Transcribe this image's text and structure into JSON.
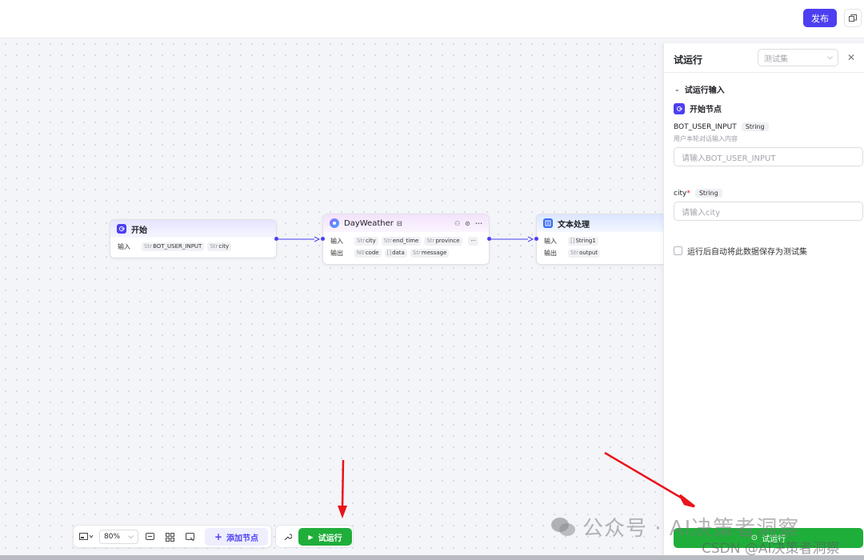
{
  "header": {
    "publish_label": "发布",
    "copy_icon": "copy-window-icon"
  },
  "nodes": {
    "start": {
      "title": "开始",
      "input_label": "输入",
      "inputs": [
        {
          "type": "Str",
          "name": "BOT_USER_INPUT"
        },
        {
          "type": "Str",
          "name": "city"
        }
      ]
    },
    "weather": {
      "title": "DayWeather",
      "input_label": "输入",
      "output_label": "输出",
      "inputs": [
        {
          "type": "Str",
          "name": "city"
        },
        {
          "type": "Str",
          "name": "end_time"
        },
        {
          "type": "Str",
          "name": "province"
        }
      ],
      "outputs": [
        {
          "type": "N0",
          "name": "code"
        },
        {
          "type": "[]",
          "name": "data"
        },
        {
          "type": "Str",
          "name": "message"
        }
      ],
      "more_label": "···"
    },
    "text": {
      "title": "文本处理",
      "input_label": "输入",
      "output_label": "输出",
      "inputs": [
        {
          "type": "[]",
          "name": "String1"
        }
      ],
      "outputs": [
        {
          "type": "Str",
          "name": "output"
        }
      ]
    }
  },
  "panel": {
    "title": "试运行",
    "select_placeholder": "测试集",
    "section_title": "试运行输入",
    "start_node_title": "开始节点",
    "field1": {
      "name": "BOT_USER_INPUT",
      "type": "String",
      "description": "用户本轮对话输入内容",
      "placeholder": "请输入BOT_USER_INPUT"
    },
    "field2": {
      "name": "city",
      "required_mark": "*",
      "type": "String",
      "placeholder": "请输入city"
    },
    "checkbox_label": "运行后自动将此数据保存为测试集",
    "run_label": "试运行"
  },
  "toolbar": {
    "zoom": "80%",
    "add_node_label": "添加节点",
    "run_label": "试运行"
  },
  "watermark": {
    "line1": "公众号 · AI决策者洞察",
    "line2": "CSDN @AI决策者洞察"
  },
  "colors": {
    "accent": "#4d3ff0",
    "run_green": "#1fae3a",
    "annotation_red": "#e8141b"
  }
}
